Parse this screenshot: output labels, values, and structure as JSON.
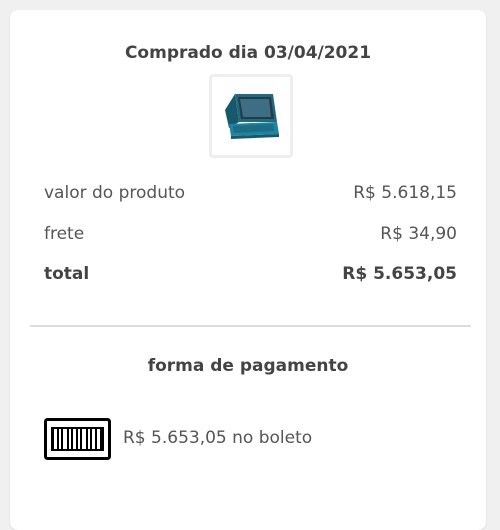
{
  "purchase": {
    "title": "Comprado dia 03/04/2021",
    "product_image": "laptop-image"
  },
  "summary": {
    "product_label": "valor do produto",
    "product_value": "R$ 5.618,15",
    "shipping_label": "frete",
    "shipping_value": "R$ 34,90",
    "total_label": "total",
    "total_value": "R$ 5.653,05"
  },
  "payment": {
    "title": "forma de pagamento",
    "icon": "barcode-icon",
    "description": "R$ 5.653,05 no boleto"
  },
  "colors": {
    "background": "#f0f0f0",
    "card": "#ffffff",
    "text": "#555555",
    "heading": "#444444",
    "divider": "#dddddd",
    "laptop": "#1e6f80"
  }
}
